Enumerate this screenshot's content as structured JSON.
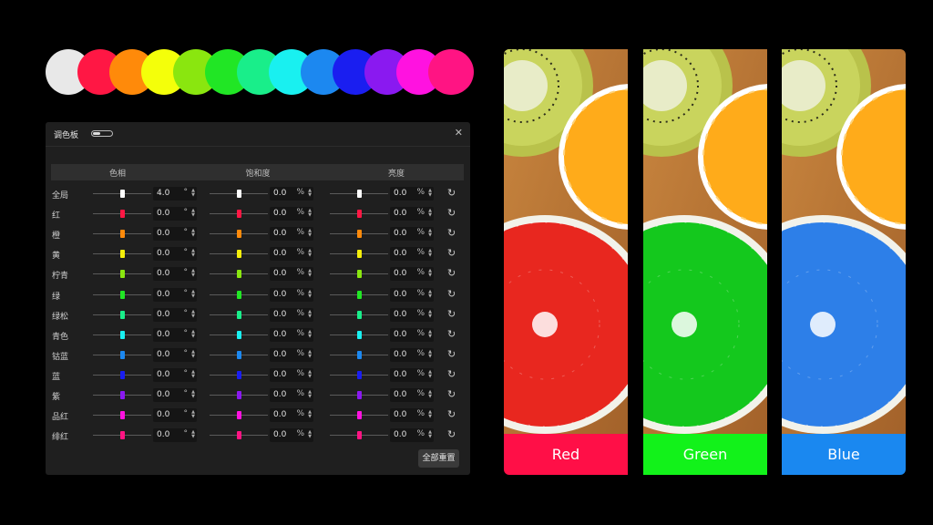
{
  "swatches": [
    "#e8e8e8",
    "#ff1744",
    "#ff8a0a",
    "#f4ff0a",
    "#8ae60f",
    "#21e625",
    "#19ee8a",
    "#19f0f0",
    "#1c88f0",
    "#1a1ef0",
    "#8a19f0",
    "#ff12e0",
    "#ff1483"
  ],
  "panel": {
    "title": "调色板",
    "column_headers": [
      "色相",
      "饱和度",
      "亮度"
    ],
    "reset_all_label": "全部重置",
    "rows": [
      {
        "label": "全局",
        "color": "#ffffff",
        "hue": "4.0",
        "sat": "0.0",
        "bri": "0.0"
      },
      {
        "label": "红",
        "color": "#ff1744",
        "hue": "0.0",
        "sat": "0.0",
        "bri": "0.0"
      },
      {
        "label": "橙",
        "color": "#ff8a0a",
        "hue": "0.0",
        "sat": "0.0",
        "bri": "0.0"
      },
      {
        "label": "黄",
        "color": "#f4ee0a",
        "hue": "0.0",
        "sat": "0.0",
        "bri": "0.0"
      },
      {
        "label": "柠青",
        "color": "#8ae60f",
        "hue": "0.0",
        "sat": "0.0",
        "bri": "0.0"
      },
      {
        "label": "绿",
        "color": "#21e625",
        "hue": "0.0",
        "sat": "0.0",
        "bri": "0.0"
      },
      {
        "label": "绿松",
        "color": "#19ee8a",
        "hue": "0.0",
        "sat": "0.0",
        "bri": "0.0"
      },
      {
        "label": "青色",
        "color": "#19f0f0",
        "hue": "0.0",
        "sat": "0.0",
        "bri": "0.0"
      },
      {
        "label": "钴蓝",
        "color": "#1c88f0",
        "hue": "0.0",
        "sat": "0.0",
        "bri": "0.0"
      },
      {
        "label": "蓝",
        "color": "#1a1ef0",
        "hue": "0.0",
        "sat": "0.0",
        "bri": "0.0"
      },
      {
        "label": "紫",
        "color": "#8a19f0",
        "hue": "0.0",
        "sat": "0.0",
        "bri": "0.0"
      },
      {
        "label": "品红",
        "color": "#ff12e0",
        "hue": "0.0",
        "sat": "0.0",
        "bri": "0.0"
      },
      {
        "label": "绯红",
        "color": "#ff1483",
        "hue": "0.0",
        "sat": "0.0",
        "bri": "0.0"
      }
    ],
    "units": {
      "hue": "°",
      "sat": "%",
      "bri": "%"
    }
  },
  "cards": [
    {
      "label": "Red",
      "bar_color": "#ff0f47",
      "fruit_color": "#e8271f"
    },
    {
      "label": "Green",
      "bar_color": "#12f21a",
      "fruit_color": "#14c81d"
    },
    {
      "label": "Blue",
      "bar_color": "#1a88f0",
      "fruit_color": "#2d7fe8"
    }
  ]
}
